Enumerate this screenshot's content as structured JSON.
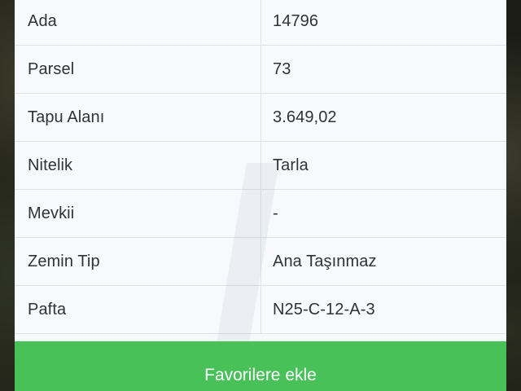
{
  "rows": [
    {
      "label": "Ada",
      "value": "14796"
    },
    {
      "label": "Parsel",
      "value": "73"
    },
    {
      "label": "Tapu Alanı",
      "value": "3.649,02"
    },
    {
      "label": "Nitelik",
      "value": "Tarla"
    },
    {
      "label": "Mevkii",
      "value": "-"
    },
    {
      "label": "Zemin Tip",
      "value": "Ana Taşınmaz"
    },
    {
      "label": "Pafta",
      "value": "N25-C-12-A-3"
    }
  ],
  "favorite_button": {
    "label": "Favorilere ekle"
  },
  "colors": {
    "button_green": "#47c158",
    "panel_background": "#f7f9fc",
    "divider": "#dde2ea",
    "text": "#2f3338"
  }
}
